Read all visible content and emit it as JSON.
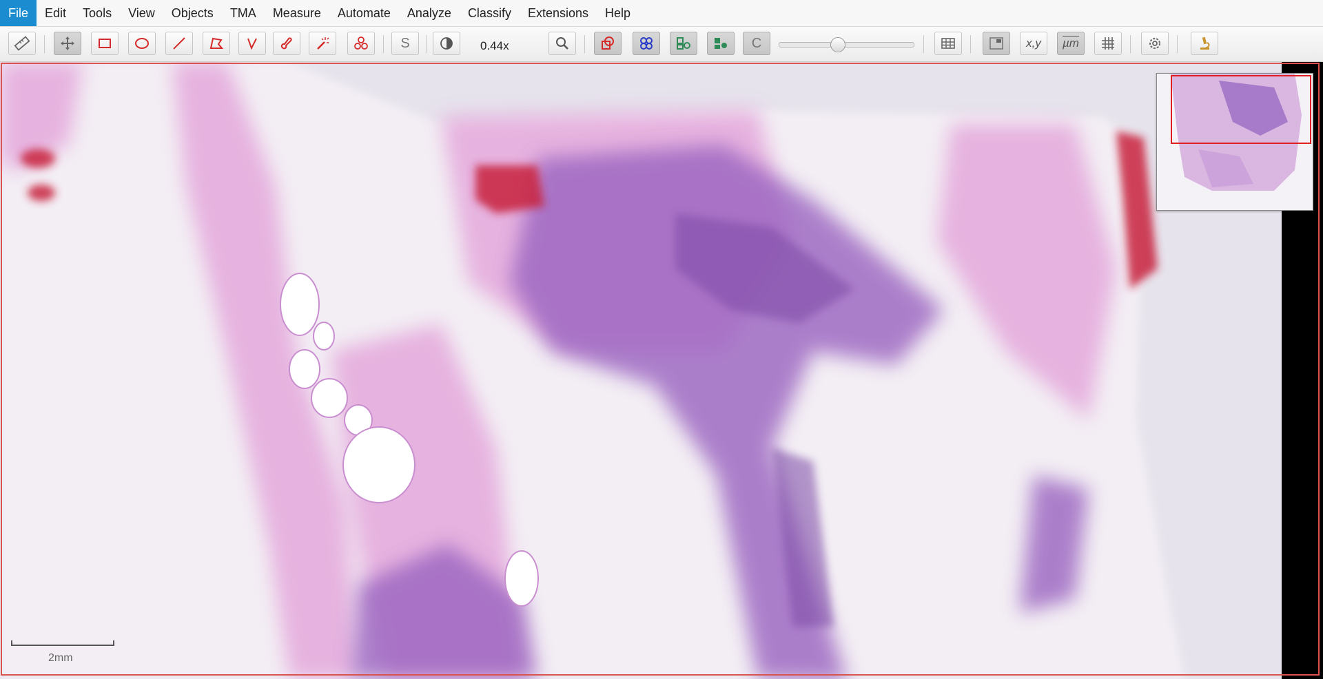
{
  "menu": {
    "items": [
      "File",
      "Edit",
      "Tools",
      "View",
      "Objects",
      "TMA",
      "Measure",
      "Automate",
      "Analyze",
      "Classify",
      "Extensions",
      "Help"
    ],
    "active": "File"
  },
  "toolbar": {
    "zoom_value": "0.44x",
    "selection_mode_label": "S",
    "cells_display_label": "C",
    "coords_label": "x,y",
    "pixel_size_label": "µm",
    "opacity_slider_fraction": 0.42
  },
  "colors": {
    "accent": "#1a8ccf",
    "tool_red": "#d42a2a",
    "viewer_border": "#d9534f",
    "tissue_pink": "#d98ad0",
    "tissue_purple": "#8a55b5"
  },
  "viewer": {
    "scale_bar_label": "2mm"
  }
}
